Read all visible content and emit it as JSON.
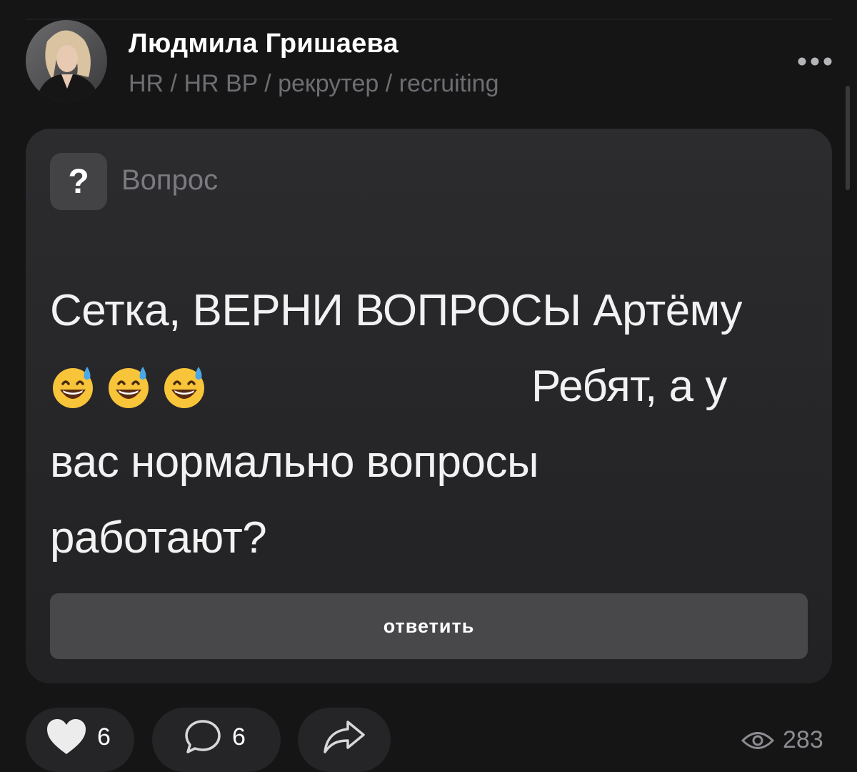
{
  "post": {
    "author": {
      "name": "Людмила Гришаева",
      "subtitle": "HR / HR BP / рекрутер / recruiting",
      "avatar_icon": "author-photo"
    },
    "menu_icon": "more-horizontal-icon",
    "question": {
      "badge_symbol": "?",
      "type_label": "Вопрос",
      "line1": "Сетка, ВЕРНИ ВОПРОСЫ Артёму",
      "emoji_icon": "grinning-face-with-sweat-emoji",
      "emoji_count": 3,
      "line2_tail": "Ребят, а у",
      "line3": "вас нормально вопросы",
      "line4": "работают?",
      "answer_label": "ответить"
    },
    "actions": {
      "likes": "6",
      "comments": "6",
      "views": "283"
    },
    "colors": {
      "background": "#151516",
      "card": "#2a2a2c",
      "muted_text": "#6d6d72",
      "button": "#48484b"
    }
  }
}
